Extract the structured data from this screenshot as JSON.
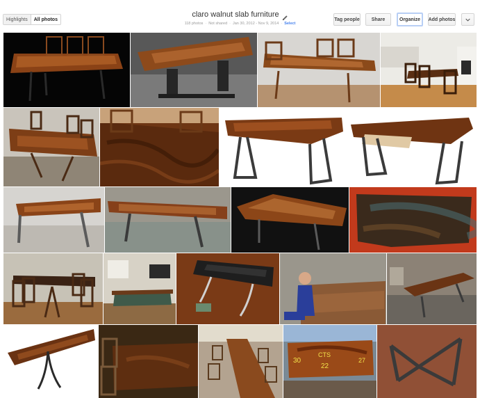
{
  "header": {
    "highlights_label": "Highlights",
    "all_photos_label": "All photos",
    "album_title": "claro walnut slab furniture",
    "photo_count": "118 photos",
    "sharing": "Not shared",
    "date_range": "Jan 30, 2012 - Nov 9, 2014",
    "select_label": "Select",
    "tag_people_label": "Tag people",
    "share_label": "Share",
    "organize_label": "Organize",
    "add_photos_label": "Add photos",
    "more_icon": "chevron-down-icon"
  },
  "photos_row1": [
    "dark slab table with chairs on black",
    "slab table on steel pedestal in workshop",
    "slab dining table with chairs",
    "walnut dining room with fireplace"
  ],
  "photos_row2": [
    "slab table with chairs top view",
    "close-up walnut table grain",
    "walnut desk with steel legs",
    "walnut desk with drawer"
  ],
  "photos_row3": [
    "slab table in gallery",
    "long slab table in warehouse",
    "slab table on dark background",
    "raw slab on red backdrop"
  ],
  "photos_row4": [
    "dining room table",
    "pool table room",
    "dark slab with chrome legs",
    "man inspecting slab",
    "workshop with slab table"
  ],
  "photos_row5": [
    "live edge slab on steel base",
    "walnut table with chairs",
    "long table with chairs",
    "marked slab CTS 22",
    "steel x-base frame"
  ],
  "colors": {
    "accent": "#427fed",
    "organize_border": "#b8cff5",
    "walnut": "#7a3e14",
    "walnut_light": "#b5652a",
    "steel": "#555555"
  }
}
